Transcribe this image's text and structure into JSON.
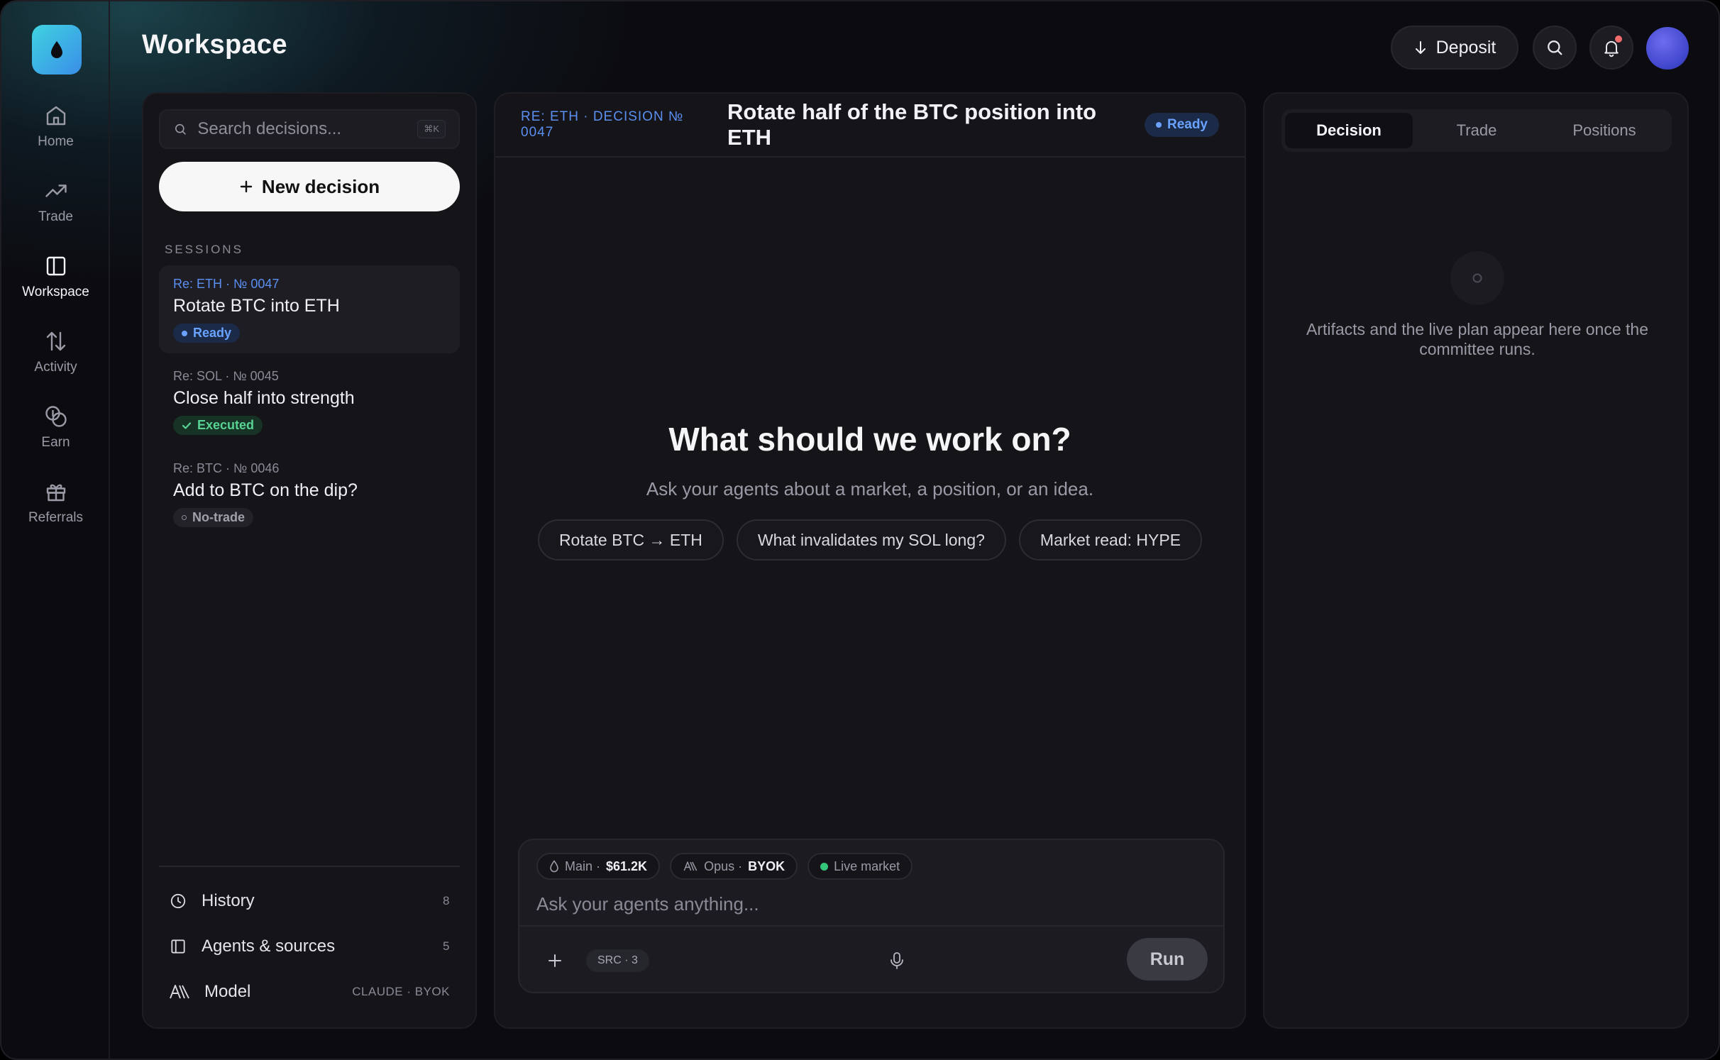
{
  "header": {
    "title": "Workspace",
    "deposit_label": "Deposit"
  },
  "nav": {
    "items": [
      {
        "label": "Home",
        "icon": "home-icon"
      },
      {
        "label": "Trade",
        "icon": "trending-up-icon"
      },
      {
        "label": "Workspace",
        "icon": "panel-icon"
      },
      {
        "label": "Activity",
        "icon": "arrows-updown-icon"
      },
      {
        "label": "Earn",
        "icon": "coins-icon"
      },
      {
        "label": "Referrals",
        "icon": "gift-icon"
      }
    ],
    "active": "Workspace"
  },
  "sidebar": {
    "search_placeholder": "Search decisions...",
    "search_shortcut": "⌘K",
    "new_decision_label": "New decision",
    "sessions_label": "SESSIONS",
    "sessions": [
      {
        "meta": "Re: ETH · № 0047",
        "title": "Rotate BTC into ETH",
        "status": "Ready",
        "status_kind": "ready"
      },
      {
        "meta": "Re: SOL · № 0045",
        "title": "Close half into strength",
        "status": "Executed",
        "status_kind": "executed"
      },
      {
        "meta": "Re: BTC · № 0046",
        "title": "Add to BTC on the dip?",
        "status": "No-trade",
        "status_kind": "none"
      }
    ],
    "footer": [
      {
        "label": "History",
        "value": "8",
        "icon": "clock-icon"
      },
      {
        "label": "Agents & sources",
        "value": "5",
        "icon": "panel-icon"
      },
      {
        "label": "Model",
        "value": "CLAUDE · BYOK",
        "icon": "anthropic-icon"
      }
    ]
  },
  "main": {
    "decision_meta": "RE: ETH · DECISION № 0047",
    "decision_title": "Rotate half of the BTC position into ETH",
    "status": "Ready",
    "hero_title": "What should we work on?",
    "hero_subtitle": "Ask your agents about a market, a position, or an idea.",
    "suggestions": [
      "Rotate BTC → ETH",
      "What invalidates my SOL long?",
      "Market read: HYPE"
    ],
    "composer": {
      "account_label": "Main ·",
      "account_value": "$61.2K",
      "model_label": "Opus ·",
      "model_value": "BYOK",
      "market_label": "Live market",
      "placeholder": "Ask your agents anything...",
      "src_label": "SRC · 3",
      "run_label": "Run"
    }
  },
  "right": {
    "tabs": [
      "Decision",
      "Trade",
      "Positions"
    ],
    "active_tab": "Decision",
    "empty_text": "Artifacts and the live plan appear here once the committee runs."
  },
  "colors": {
    "accent_blue": "#5b8ff0",
    "ready": "#6aa2ff",
    "executed": "#58d394",
    "live": "#34c77b"
  }
}
